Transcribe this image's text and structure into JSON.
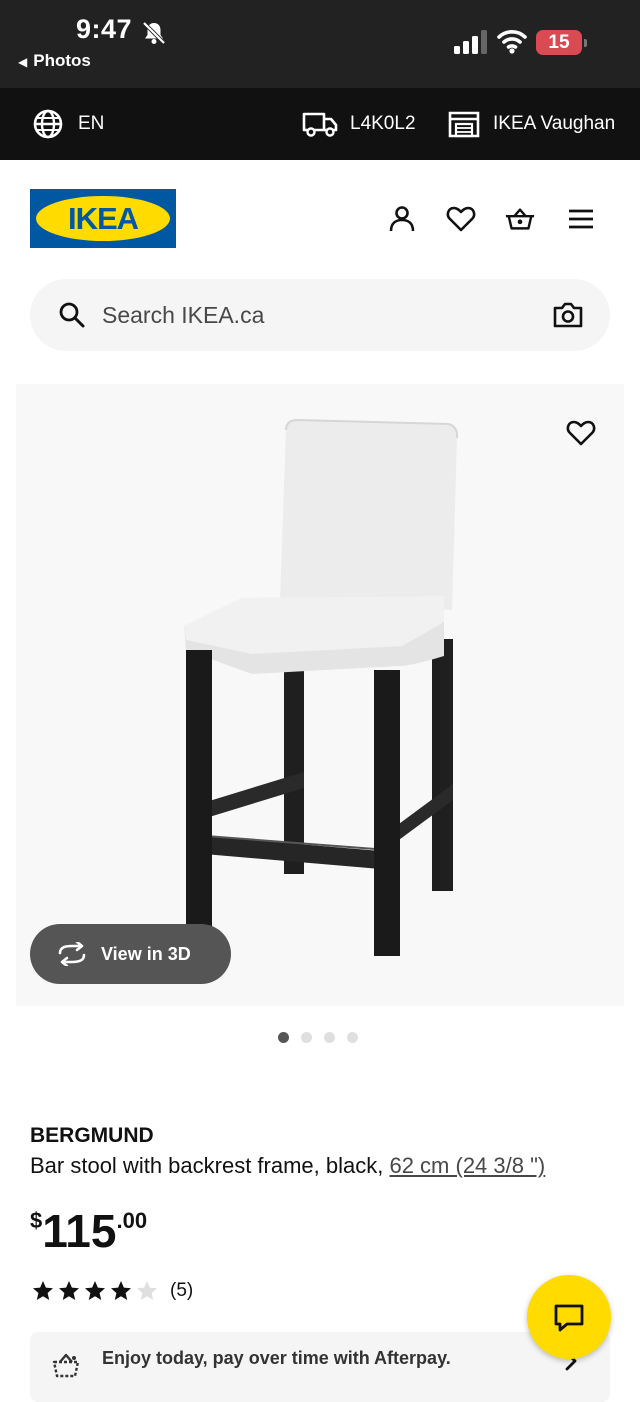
{
  "status_bar": {
    "time": "9:47",
    "back_label": "Photos",
    "battery_level": "15"
  },
  "top_bar": {
    "language": "EN",
    "postal_code": "L4K0L2",
    "store": "IKEA Vaughan"
  },
  "header": {
    "logo_text": "IKEA"
  },
  "search": {
    "placeholder": "Search IKEA.ca"
  },
  "gallery": {
    "view_3d_label": "View in 3D",
    "image_count": 4,
    "active_index": 0
  },
  "product": {
    "name": "BERGMUND",
    "description": "Bar stool with backrest frame, black, ",
    "size": "62 cm (24 3/8 \")",
    "price_currency": "$",
    "price_integer": "115",
    "price_decimal": ".00",
    "rating": 4,
    "rating_max": 5,
    "review_count": "(5)"
  },
  "afterpay": {
    "text": "Enjoy today, pay over time with Afterpay."
  },
  "colors": {
    "ikea_blue": "#0058a3",
    "ikea_yellow": "#ffdb00",
    "top_bar_bg": "#111111",
    "battery_red": "#d94a52"
  }
}
